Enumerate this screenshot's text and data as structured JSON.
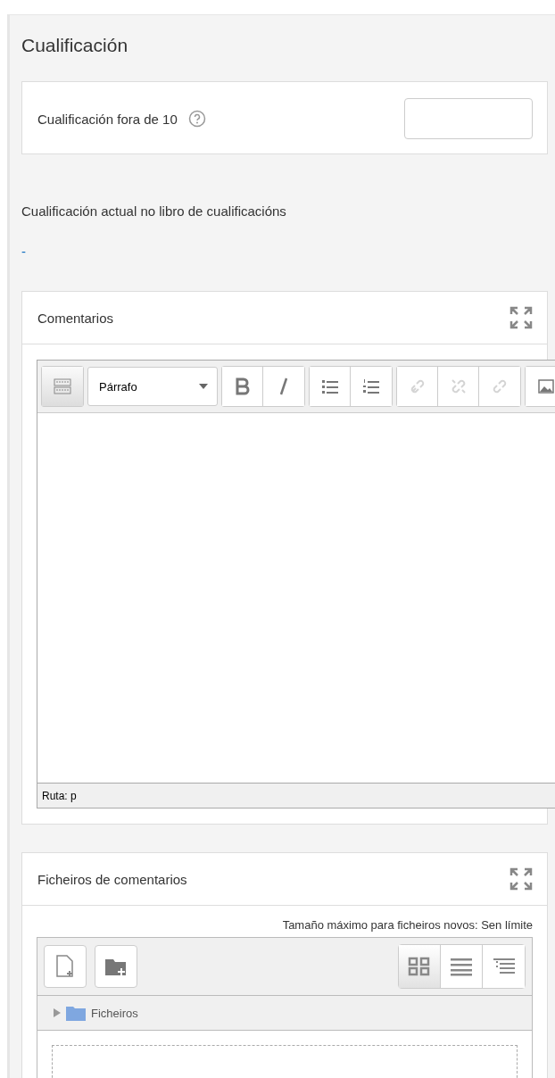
{
  "section": {
    "title": "Cualificación"
  },
  "grade": {
    "label": "Cualificación fora de 10"
  },
  "current_grade": {
    "label": "Cualificación actual no libro de cualificacións",
    "value": "-"
  },
  "comments": {
    "title": "Comentarios",
    "format": "Párrafo",
    "path": "Ruta: p",
    "toolbar": [
      {
        "kind": "toggle",
        "disabled": false
      },
      {
        "kind": "bold",
        "disabled": false
      },
      {
        "kind": "italic",
        "disabled": false
      },
      {
        "kind": "bullets",
        "disabled": false
      },
      {
        "kind": "numbers",
        "disabled": false
      },
      {
        "kind": "link",
        "disabled": true
      },
      {
        "kind": "unlink",
        "disabled": true
      },
      {
        "kind": "anchor",
        "disabled": true
      },
      {
        "kind": "image",
        "disabled": false
      }
    ]
  },
  "files": {
    "title": "Ficheiros de comentarios",
    "max_size": "Tamaño máximo para ficheiros novos: Sen límite",
    "folder": "Ficheiros",
    "views": [
      {
        "kind": "icons",
        "selected": true
      },
      {
        "kind": "list",
        "selected": false
      },
      {
        "kind": "tree",
        "selected": false
      }
    ]
  }
}
